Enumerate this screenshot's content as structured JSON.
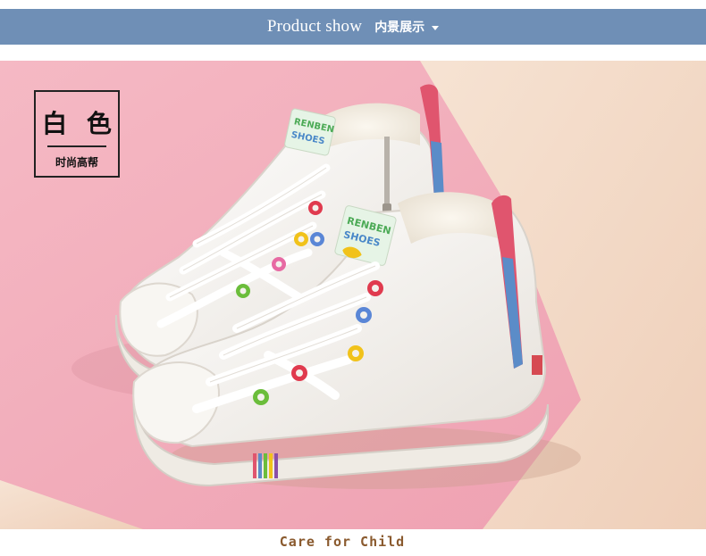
{
  "header": {
    "title": "Product show",
    "subtitle": "内景展示",
    "dropdown_icon": "caret-down-icon",
    "bg_color": "#6f8fb6"
  },
  "photo": {
    "description_icon": "product-photo-white-high-top-sneakers",
    "colors": {
      "pink_background": "#f2b3bf",
      "cream_background": "#f3dccb",
      "shoe_white": "#f4f1ec"
    }
  },
  "tag": {
    "title": "白 色",
    "subtitle": "时尚高帮"
  },
  "footer": {
    "text": "Care for Child",
    "color": "#8a5a2e"
  }
}
